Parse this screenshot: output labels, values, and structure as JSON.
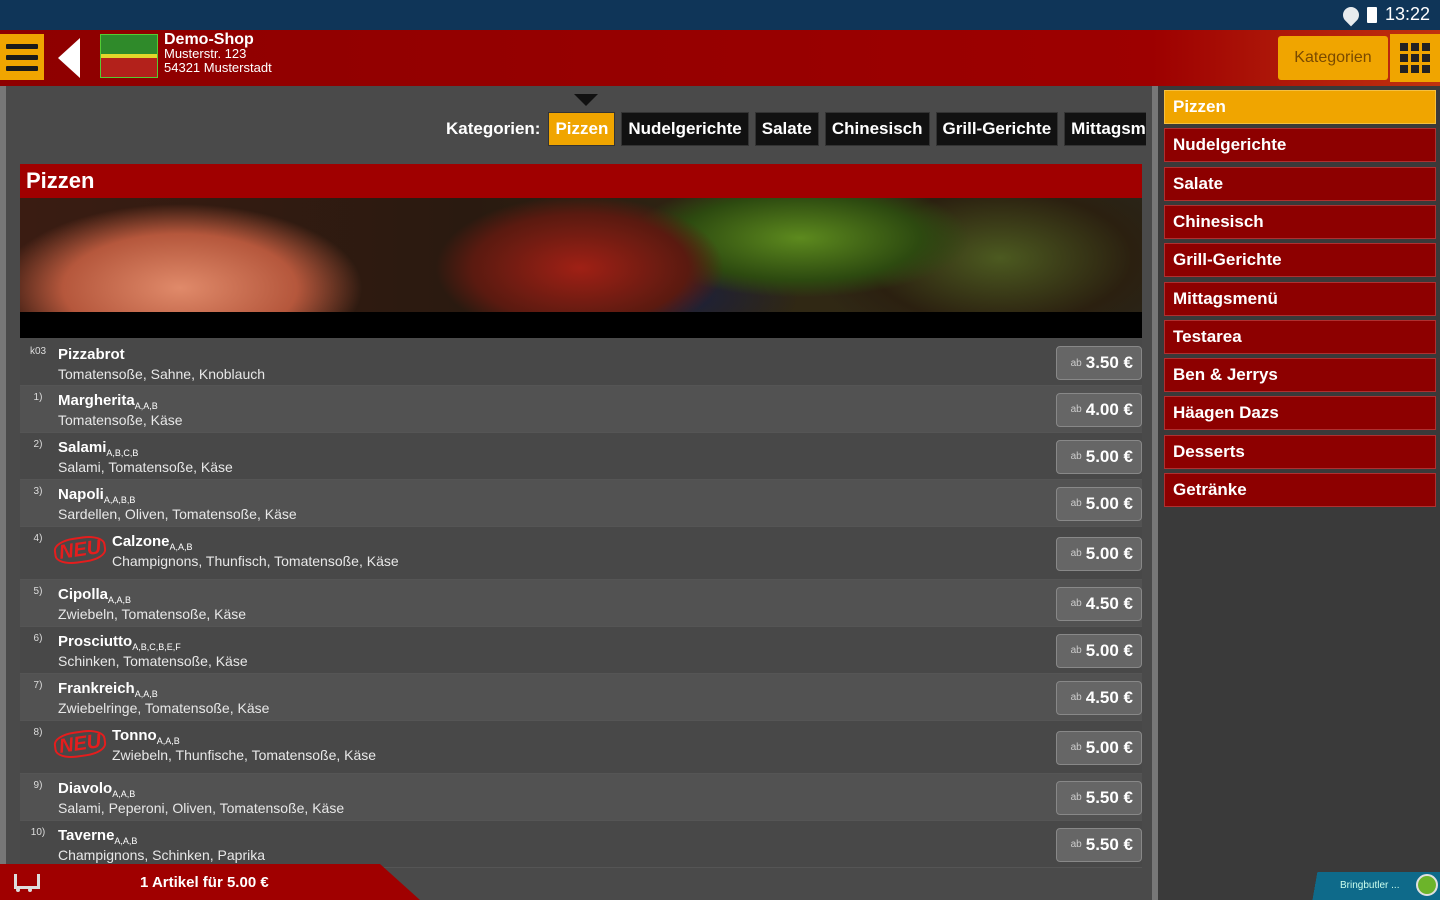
{
  "status": {
    "time": "13:22"
  },
  "header": {
    "shop_name": "Demo-Shop",
    "street": "Musterstr. 123",
    "city": "54321 Musterstadt",
    "categories_button": "Kategorien"
  },
  "tabs": {
    "label": "Kategorien:",
    "items": [
      "Pizzen",
      "Nudelgerichte",
      "Salate",
      "Chinesisch",
      "Grill-Gerichte",
      "Mittagsmen"
    ]
  },
  "section": {
    "title": "Pizzen"
  },
  "items": [
    {
      "num": "k03",
      "name": "Pizzabrot",
      "sup": "",
      "desc": "Tomatensoße, Sahne, Knoblauch",
      "price": "3.50 €",
      "ab": "ab",
      "neu": false
    },
    {
      "num": "1)",
      "name": "Margherita",
      "sup": "A,A,B",
      "desc": "Tomatensoße, Käse",
      "price": "4.00 €",
      "ab": "ab",
      "neu": false
    },
    {
      "num": "2)",
      "name": "Salami",
      "sup": "A,B,C,B",
      "desc": "Salami, Tomatensoße, Käse",
      "price": "5.00 €",
      "ab": "ab",
      "neu": false
    },
    {
      "num": "3)",
      "name": "Napoli",
      "sup": "A,A,B,B",
      "desc": "Sardellen, Oliven, Tomatensoße, Käse",
      "price": "5.00 €",
      "ab": "ab",
      "neu": false
    },
    {
      "num": "4)",
      "name": "Calzone",
      "sup": "A,A,B",
      "desc": "Champignons, Thunfisch, Tomatensoße, Käse",
      "price": "5.00 €",
      "ab": "ab",
      "neu": true
    },
    {
      "num": "5)",
      "name": "Cipolla",
      "sup": "A,A,B",
      "desc": "Zwiebeln, Tomatensoße, Käse",
      "price": "4.50 €",
      "ab": "ab",
      "neu": false
    },
    {
      "num": "6)",
      "name": "Prosciutto",
      "sup": "A,B,C,B,E,F",
      "desc": "Schinken, Tomatensoße, Käse",
      "price": "5.00 €",
      "ab": "ab",
      "neu": false
    },
    {
      "num": "7)",
      "name": "Frankreich",
      "sup": "A,A,B",
      "desc": "Zwiebelringe, Tomatensoße, Käse",
      "price": "4.50 €",
      "ab": "ab",
      "neu": false
    },
    {
      "num": "8)",
      "name": "Tonno",
      "sup": "A,A,B",
      "desc": "Zwiebeln, Thunfische, Tomatensoße, Käse",
      "price": "5.00 €",
      "ab": "ab",
      "neu": true
    },
    {
      "num": "9)",
      "name": "Diavolo",
      "sup": "A,A,B",
      "desc": "Salami, Peperoni, Oliven, Tomatensoße, Käse",
      "price": "5.50 €",
      "ab": "ab",
      "neu": false
    },
    {
      "num": "10)",
      "name": "Taverne",
      "sup": "A,A,B",
      "desc": "Champignons, Schinken, Paprika",
      "price": "5.50 €",
      "ab": "ab",
      "neu": false
    }
  ],
  "neu_label": "NEU",
  "cart": {
    "text": "1 Artikel für 5.00 €"
  },
  "sidebar": {
    "items": [
      "Pizzen",
      "Nudelgerichte",
      "Salate",
      "Chinesisch",
      "Grill-Gerichte",
      "Mittagsmenü",
      "Testarea",
      "Ben & Jerrys",
      "Häagen Dazs",
      "Desserts",
      "Getränke"
    ]
  },
  "brand": {
    "text": "Bringbutler ..."
  }
}
